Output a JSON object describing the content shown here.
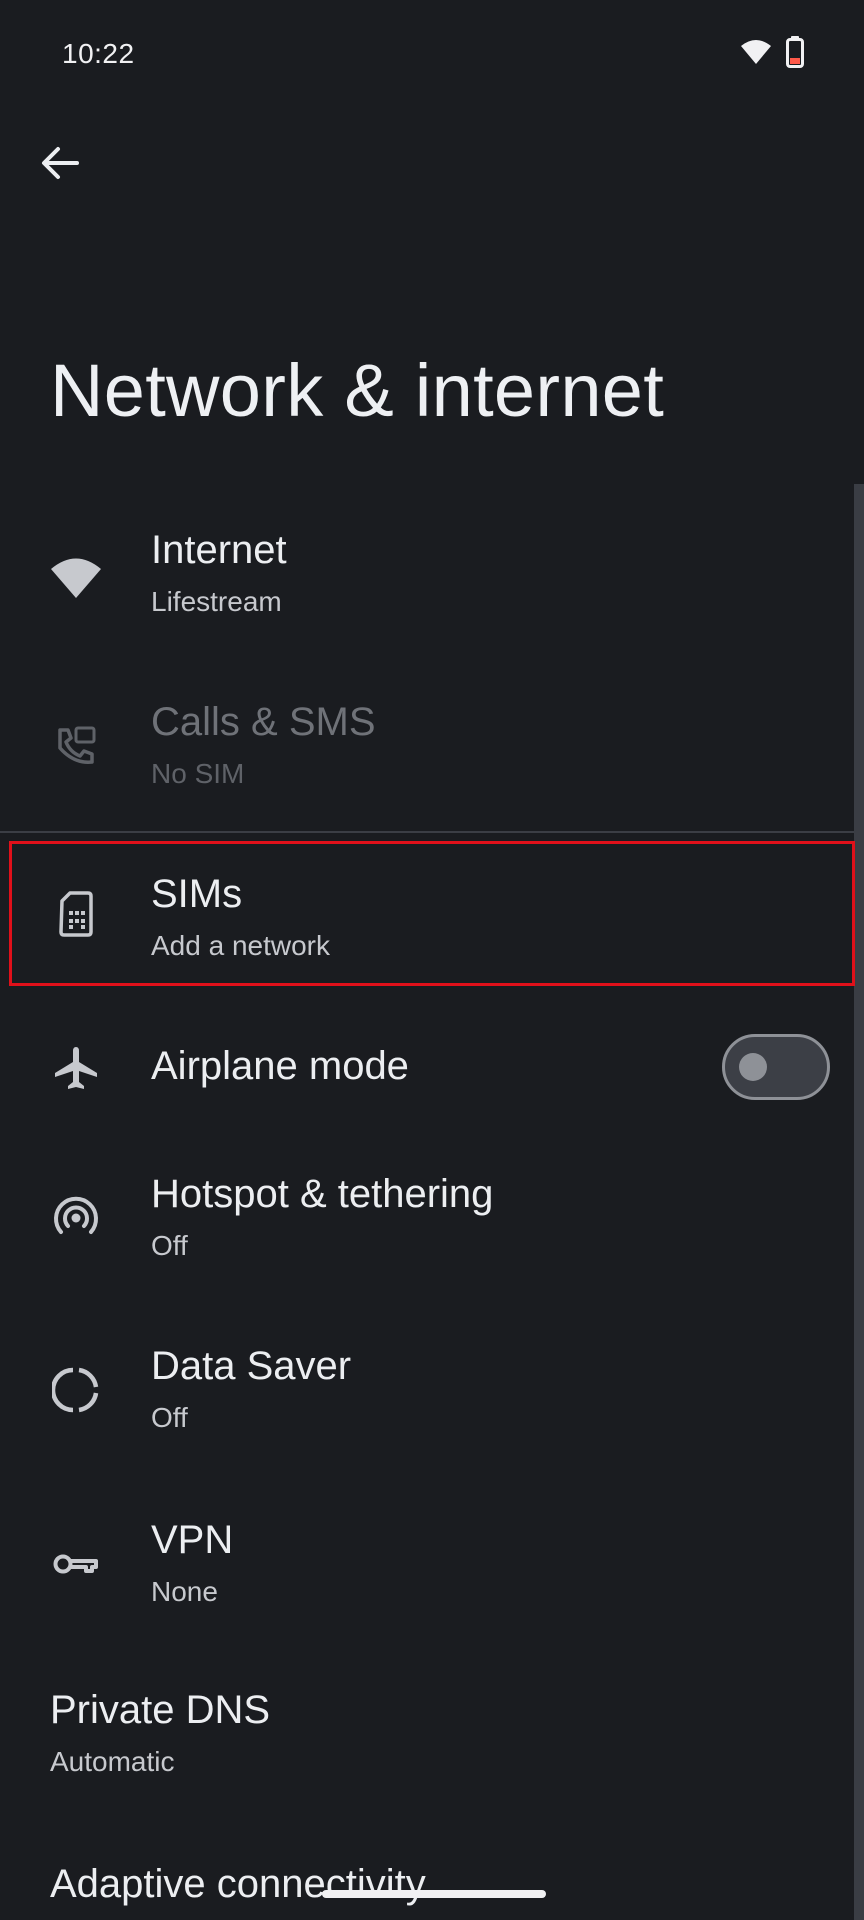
{
  "status_bar": {
    "time": "10:22",
    "icons": [
      "wifi-icon",
      "battery-icon"
    ]
  },
  "header": {
    "back_icon": "arrow-back-icon",
    "title": "Network & internet"
  },
  "items": [
    {
      "icon": "wifi-icon",
      "title": "Internet",
      "subtitle": "Lifestream",
      "enabled": true
    },
    {
      "icon": "calls-sms-icon",
      "title": "Calls & SMS",
      "subtitle": "No SIM",
      "enabled": false
    },
    {
      "icon": "sim-card-icon",
      "title": "SIMs",
      "subtitle": "Add a network",
      "enabled": true,
      "highlighted": true
    },
    {
      "icon": "airplane-icon",
      "title": "Airplane mode",
      "toggle": false
    },
    {
      "icon": "hotspot-icon",
      "title": "Hotspot & tethering",
      "subtitle": "Off"
    },
    {
      "icon": "data-saver-icon",
      "title": "Data Saver",
      "subtitle": "Off"
    },
    {
      "icon": "vpn-key-icon",
      "title": "VPN",
      "subtitle": "None"
    },
    {
      "title": "Private DNS",
      "subtitle": "Automatic"
    },
    {
      "title": "Adaptive connectivity"
    }
  ],
  "colors": {
    "background": "#1a1c20",
    "text_primary": "#eceef1",
    "text_secondary": "#c7c9ce",
    "text_disabled": "#6f7278",
    "highlight": "#e0101a"
  }
}
